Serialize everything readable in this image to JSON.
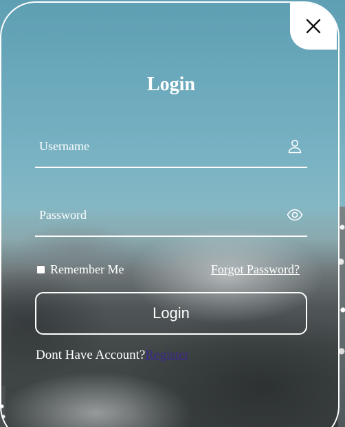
{
  "dialog": {
    "title": "Login",
    "close_icon": "close-icon"
  },
  "form": {
    "username": {
      "placeholder": "Username",
      "value": "",
      "icon": "user-icon"
    },
    "password": {
      "placeholder": "Password",
      "value": "",
      "icon": "eye-icon"
    },
    "remember_label": "Remember Me",
    "remember_checked": false,
    "forgot_label": "Forgot Password?",
    "submit_label": "Login"
  },
  "footer": {
    "prompt": "Dont Have Account?",
    "register_label": "Register"
  },
  "colors": {
    "text": "#ffffff",
    "link_visited": "#3a2a8a",
    "sky": "#6aa8bb",
    "ground": "#3b4040"
  }
}
